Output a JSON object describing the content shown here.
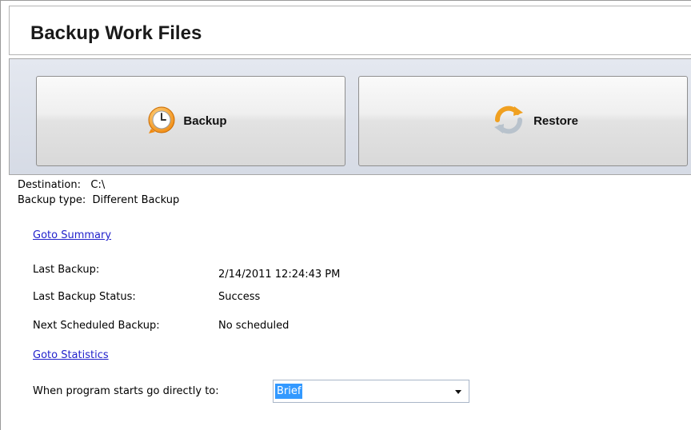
{
  "window": {
    "title": "Backup Work Files"
  },
  "toolbar": {
    "backup_label": "Backup",
    "backup_icon": "clock-backup-icon",
    "restore_label": "Restore",
    "restore_icon": "refresh-restore-icon"
  },
  "info": {
    "destination_label": "Destination:",
    "destination_value": "C:\\",
    "backup_type_label": "Backup type:",
    "backup_type_value": "Different Backup"
  },
  "links": {
    "goto_summary": "Goto Summary",
    "goto_statistics": "Goto Statistics"
  },
  "summary": {
    "last_backup_label": "Last Backup:",
    "last_backup_value": "2/14/2011 12:24:43 PM",
    "last_status_label": "Last Backup Status:",
    "last_status_value": "Success",
    "next_scheduled_label": "Next Scheduled Backup:",
    "next_scheduled_value": "No scheduled"
  },
  "startup": {
    "label": "When program starts go directly to:",
    "selected": "Brief"
  },
  "colors": {
    "link": "#2222cc",
    "selection": "#3399ff",
    "toolbar_bg": "#dde1ea"
  }
}
